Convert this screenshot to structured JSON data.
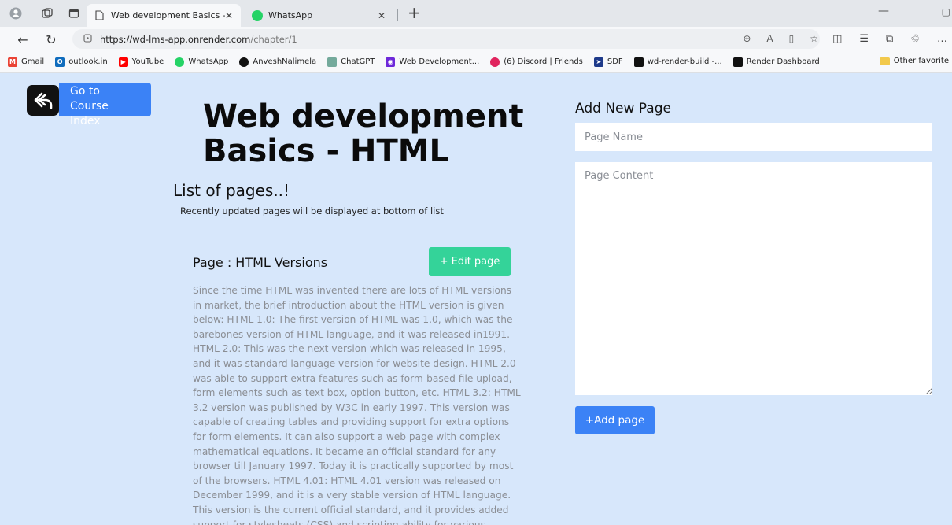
{
  "browser": {
    "tabs": [
      {
        "title": "Web development Basics - HTML",
        "active": true
      },
      {
        "title": "WhatsApp",
        "active": false
      }
    ],
    "url_host": "https://wd-lms-app.onrender.com",
    "url_path": "/chapter/1",
    "bookmarks": [
      {
        "label": "Gmail",
        "icon": "gmail-icon",
        "color": "#ea4335"
      },
      {
        "label": "outlook.in",
        "icon": "outlook-icon",
        "color": "#0f6cbd"
      },
      {
        "label": "YouTube",
        "icon": "youtube-icon",
        "color": "#ff0000"
      },
      {
        "label": "WhatsApp",
        "icon": "whatsapp-icon",
        "color": "#25d366"
      },
      {
        "label": "AnveshNalimela",
        "icon": "github-icon",
        "color": "#111111"
      },
      {
        "label": "ChatGPT",
        "icon": "chatgpt-icon",
        "color": "#74aa9c"
      },
      {
        "label": "Web Development...",
        "icon": "eye-icon",
        "color": "#6d28d9"
      },
      {
        "label": "(6) Discord | Friends",
        "icon": "discord-icon",
        "color": "#e0245e"
      },
      {
        "label": "SDF",
        "icon": "bird-icon",
        "color": "#1e3a8a"
      },
      {
        "label": "wd-render-build -...",
        "icon": "render-icon",
        "color": "#111111"
      },
      {
        "label": "Render Dashboard",
        "icon": "render-icon",
        "color": "#111111"
      }
    ],
    "other_favorites": "Other favorite"
  },
  "header": {
    "course_index_label": "Go to Course Index",
    "chapter_title": "Web development Basics - HTML"
  },
  "pages": {
    "heading": "List of pages..!",
    "subheading": "Recently updated pages will be displayed at bottom of list",
    "items": [
      {
        "name": "Page : HTML Versions",
        "edit_label": "+ Edit page",
        "content": "Since the time HTML was invented there are lots of HTML versions in market, the brief introduction about the HTML version is given below: HTML 1.0: The first version of HTML was 1.0, which was the barebones version of HTML language, and it was released in1991. HTML 2.0: This was the next version which was released in 1995, and it was standard language version for website design. HTML 2.0 was able to support extra features such as form-based file upload, form elements such as text box, option button, etc. HTML 3.2: HTML 3.2 version was published by W3C in early 1997. This version was capable of creating tables and providing support for extra options for form elements. It can also support a web page with complex mathematical equations. It became an official standard for any browser till January 1997. Today it is practically supported by most of the browsers. HTML 4.01: HTML 4.01 version was released on December 1999, and it is a very stable version of HTML language. This version is the current official standard, and it provides added support for stylesheets (CSS) and scripting ability for various multimedia elements."
      }
    ]
  },
  "add_form": {
    "heading": "Add New Page",
    "name_placeholder": "Page Name",
    "content_placeholder": "Page Content",
    "submit_label": "+Add page"
  },
  "colors": {
    "page_bg": "#d7e7fb",
    "primary_blue": "#3b82f6",
    "edit_green": "#34d399"
  }
}
